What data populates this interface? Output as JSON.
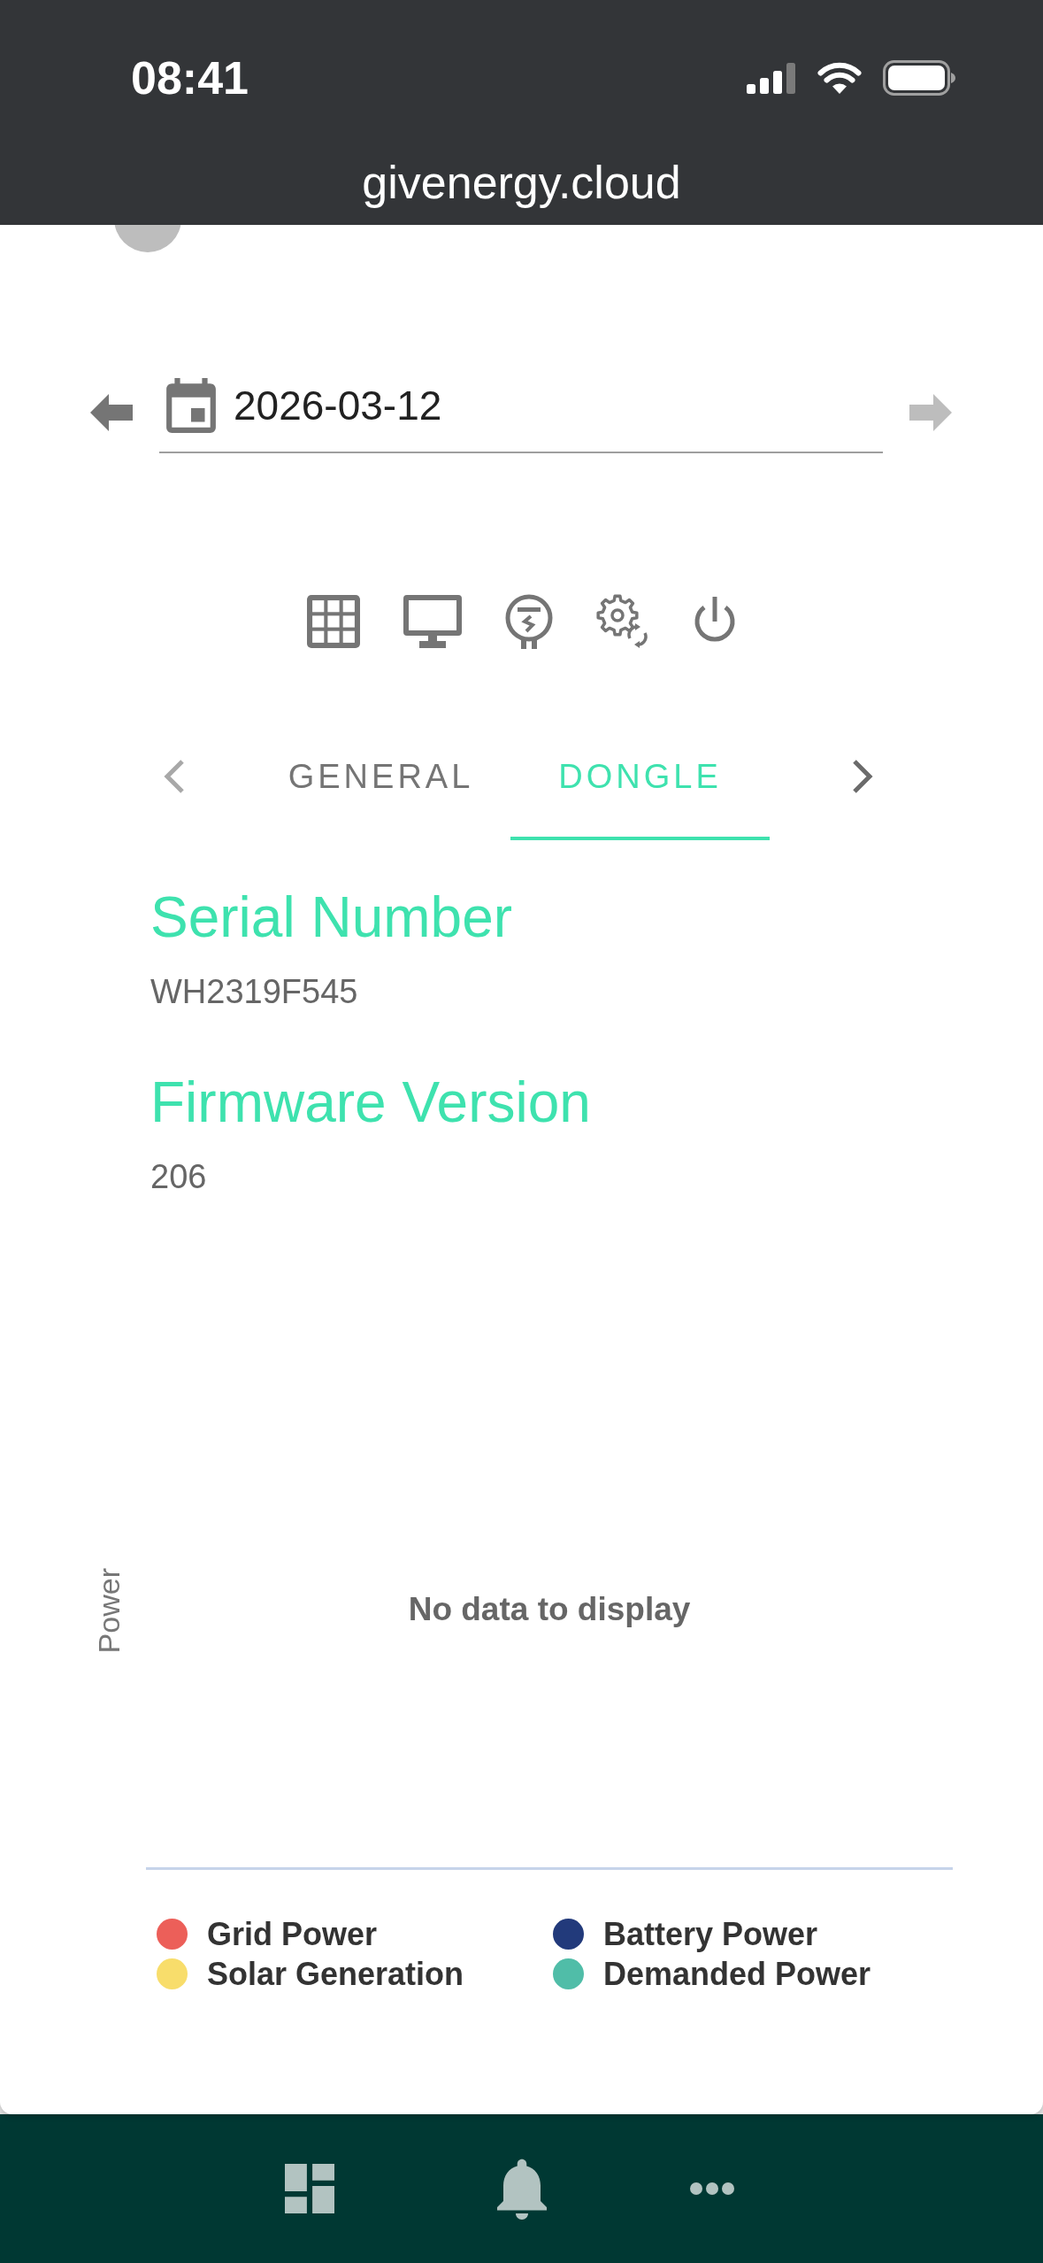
{
  "status_bar": {
    "time": "08:41"
  },
  "browser": {
    "url": "givenergy.cloud"
  },
  "date_picker": {
    "previous": {
      "disabled": false
    },
    "value": "2026-03-12",
    "next": {
      "disabled": true
    }
  },
  "tabs": {
    "scroll_back": {
      "disabled": true
    },
    "items": [
      {
        "label": "GENERAL",
        "selected": false
      },
      {
        "label": "DONGLE",
        "selected": true
      }
    ],
    "scroll_forward": {
      "disabled": false
    }
  },
  "details": [
    {
      "label": "Serial Number",
      "value": "WH2319F545"
    },
    {
      "label": "Firmware Version",
      "value": "206"
    }
  ],
  "power_chart": {
    "ylabel": "Power",
    "message": "No data to display",
    "legend": [
      {
        "label": "Grid Power",
        "color": "#ec5f59"
      },
      {
        "label": "Battery Power",
        "color": "#223a7b"
      },
      {
        "label": "Solar Generation",
        "color": "#f8dd6b"
      },
      {
        "label": "Demanded Power",
        "color": "#50bda8"
      }
    ]
  }
}
